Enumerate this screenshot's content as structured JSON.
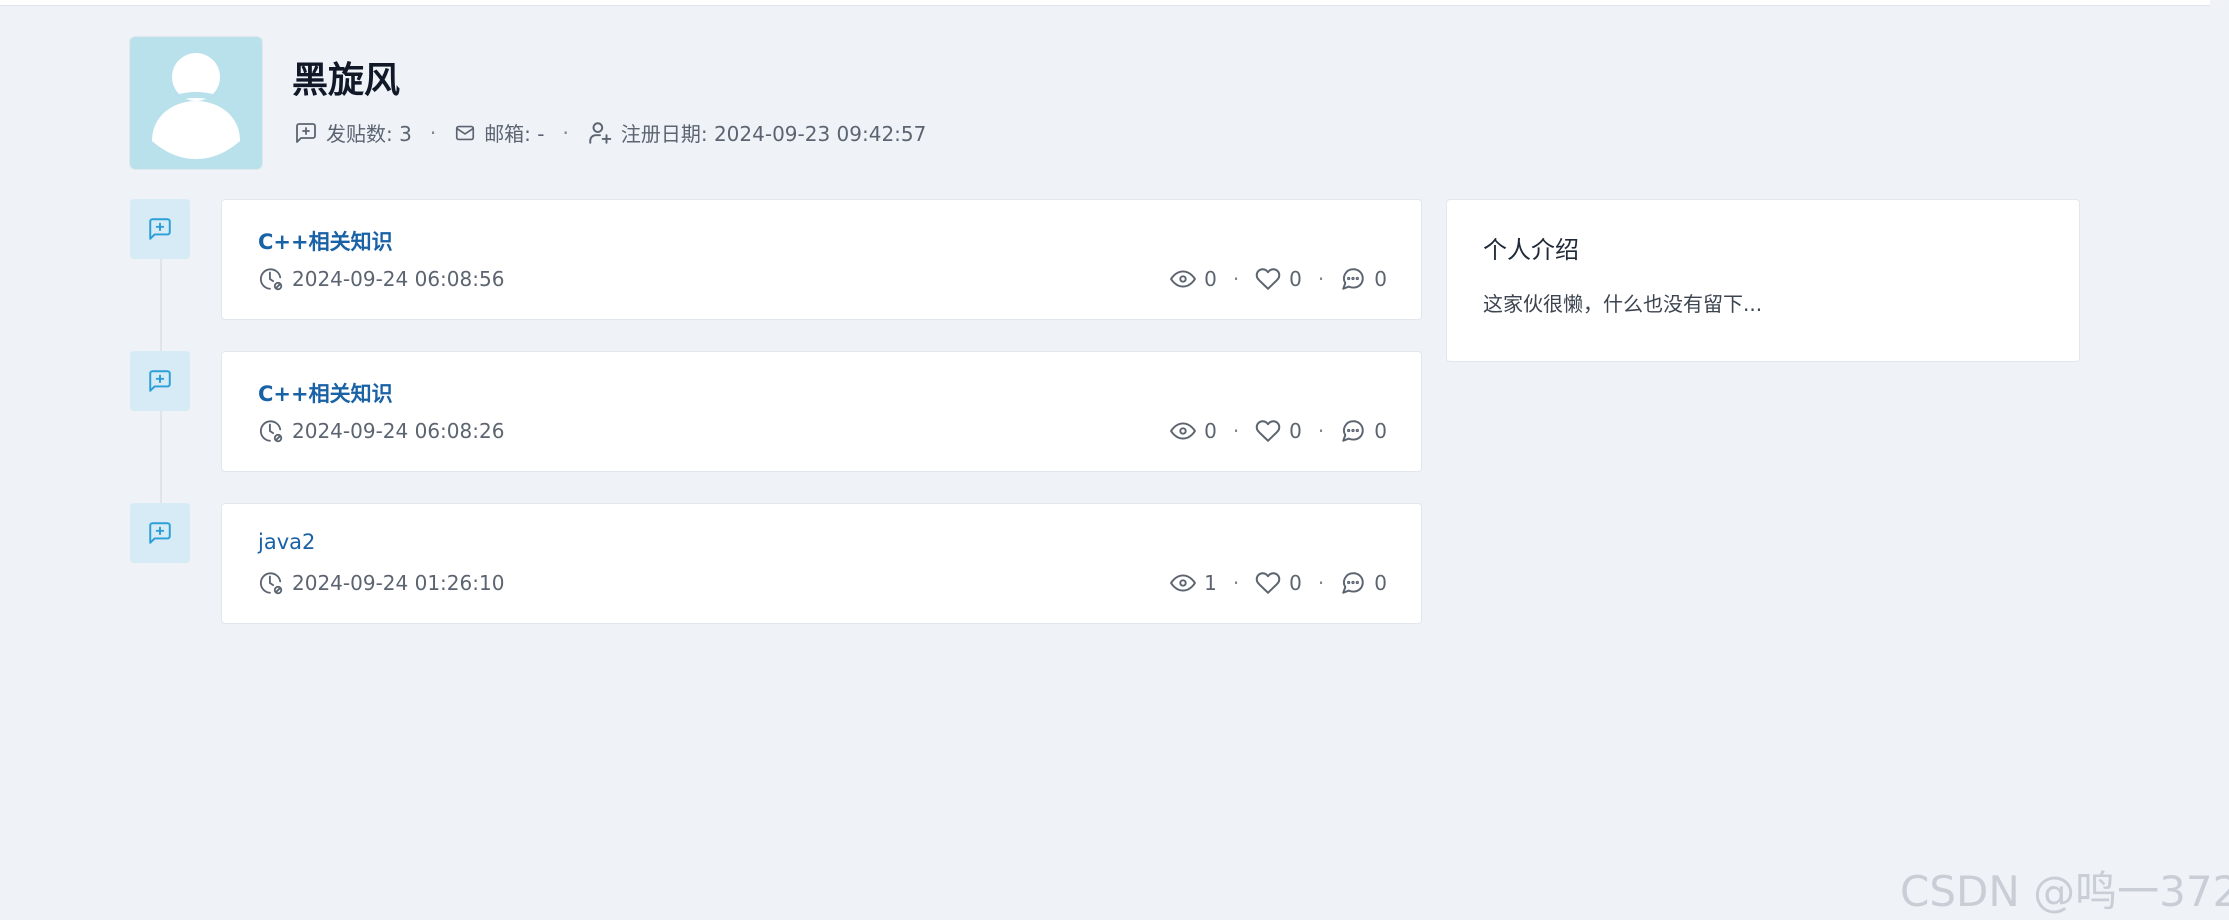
{
  "user": {
    "name": "黑旋风",
    "avatar_icon": "default-user-avatar",
    "post_count_label": "发贴数: 3",
    "email_label": "邮箱: -",
    "register_label": "注册日期: 2024-09-23 09:42:57"
  },
  "separators": {
    "dot": "·"
  },
  "posts": [
    {
      "title": "C++相关知识",
      "date": "2024-09-24 06:08:56",
      "views": "0",
      "likes": "0",
      "comments": "0"
    },
    {
      "title": "C++相关知识",
      "date": "2024-09-24 06:08:26",
      "views": "0",
      "likes": "0",
      "comments": "0"
    },
    {
      "title": "java2",
      "date": "2024-09-24 01:26:10",
      "views": "1",
      "likes": "0",
      "comments": "0"
    }
  ],
  "intro": {
    "title": "个人介绍",
    "text": "这家伙很懒，什么也没有留下..."
  },
  "watermark": "CSDN @鸣一372",
  "icons": {
    "post": "message-square-plus-icon",
    "email": "mail-icon",
    "register": "user-plus-icon",
    "date": "clock-icon",
    "views": "eye-icon",
    "likes": "heart-icon",
    "comments": "message-circle-icon"
  },
  "colors": {
    "accent": "#1a62a6",
    "icon_tile": "#d6ebf6",
    "icon_tile_fg": "#2a9fd8",
    "avatar_bg": "#b9e1ec",
    "page_bg": "#eff3f8"
  }
}
